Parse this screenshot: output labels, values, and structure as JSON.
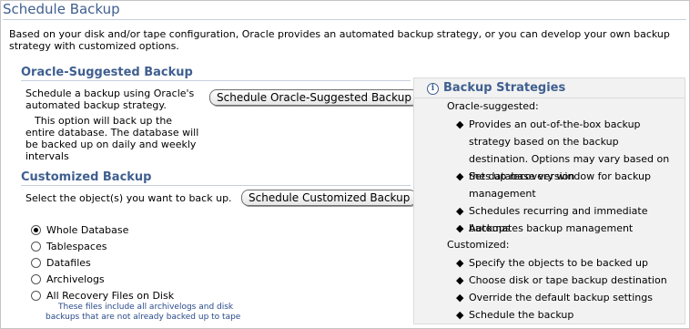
{
  "page": {
    "title": "Schedule Backup",
    "intro": "Based on your disk and/or tape configuration, Oracle provides an automated backup strategy, or you can develop your own backup strategy with customized options."
  },
  "suggested": {
    "title": "Oracle-Suggested Backup",
    "description": "Schedule a backup using Oracle's automated backup strategy.",
    "detail": "This option will back up the entire database. The database will be backed up on daily and weekly intervals",
    "button_label": "Schedule Oracle-Suggested Backup"
  },
  "customized": {
    "title": "Customized Backup",
    "prompt": "Select the object(s) you want to back up.",
    "button_label": "Schedule Customized Backup",
    "options": [
      {
        "label": "Whole Database",
        "selected": true
      },
      {
        "label": "Tablespaces",
        "selected": false
      },
      {
        "label": "Datafiles",
        "selected": false
      },
      {
        "label": "Archivelogs",
        "selected": false
      },
      {
        "label": "All Recovery Files on Disk",
        "selected": false
      }
    ],
    "recovery_note_line1": "These files include all archivelogs and disk",
    "recovery_note_line2": "backups that are not already backed up to tape"
  },
  "strategies": {
    "title": "Backup Strategies",
    "icon": "info-icon",
    "oracle_heading": "Oracle-suggested:",
    "oracle_items": [
      "Provides an out-of-the-box backup strategy based on the backup destination. Options may vary based on the database version",
      "Sets up recovery window for backup management",
      "Schedules recurring and immediate backups",
      "Automates backup management"
    ],
    "custom_heading": "Customized:",
    "custom_items": [
      "Specify the objects to be backed up",
      "Choose disk or tape backup destination",
      "Override the default backup settings",
      "Schedule the backup"
    ]
  }
}
